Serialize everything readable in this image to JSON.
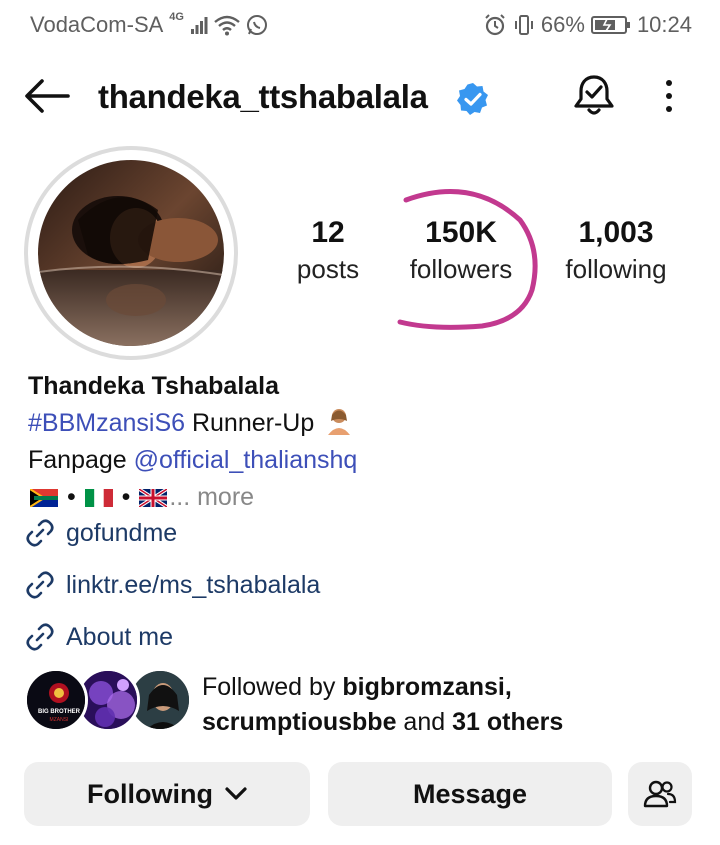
{
  "status_bar": {
    "carrier": "VodaCom-SA",
    "network": "4G",
    "battery": "66%",
    "time": "10:24"
  },
  "header": {
    "username": "thandeka_ttshabalala",
    "verified": true,
    "icons": [
      "back-arrow-icon",
      "verified-badge-icon",
      "notification-bell-icon",
      "more-options-icon"
    ]
  },
  "stats": {
    "posts_count": "12",
    "posts_label": "posts",
    "followers_count": "150K",
    "followers_label": "followers",
    "following_count": "1,003",
    "following_label": "following"
  },
  "bio": {
    "name": "Thandeka Tshabalala",
    "hashtag": "#BBMzansiS6",
    "line1_rest": " Runner-Up",
    "line2_prefix": "Fanpage ",
    "mention": "@official_thalianshq",
    "more": "... more",
    "dot": " • "
  },
  "links": [
    {
      "label": "gofundme"
    },
    {
      "label": "linktr.ee/ms_tshabalala"
    },
    {
      "label": "About me"
    }
  ],
  "followed_by": {
    "prefix": "Followed by ",
    "user1": "bigbromzansi,",
    "user2": "scrumptiousbbe",
    "and": " and ",
    "others": "31 others",
    "avatar1_text_top": "BIG BROTHER",
    "avatar1_text_bottom": "MZANSI"
  },
  "buttons": {
    "following": "Following",
    "message": "Message"
  },
  "colors": {
    "accent_link": "#3d4fb8",
    "verified_blue": "#3897f0",
    "annotation_pink": "#c2398f",
    "button_bg": "#efefef"
  }
}
